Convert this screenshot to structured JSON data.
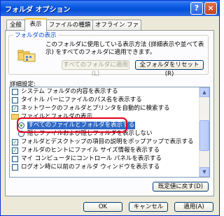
{
  "window": {
    "title": "フォルダ オプション",
    "help_label": "?",
    "close_label": "×"
  },
  "tabs": [
    {
      "label": "全般"
    },
    {
      "label": "表示"
    },
    {
      "label": "ファイルの種類"
    },
    {
      "label": "オフライン ファイル"
    }
  ],
  "folder_view": {
    "group_label": "フォルダの表示",
    "description": "このフォルダに使用している表示方法 (詳細表示や並べて表示) をすべてのフォルダに適用できます。",
    "apply_all_label": "すべてのフォルダに適用(L)",
    "reset_all_label": "全フォルダをリセット(R)"
  },
  "advanced": {
    "label": "詳細設定:",
    "items": [
      {
        "type": "checkbox",
        "checked": false,
        "label": "システム フォルダの内容を表示する"
      },
      {
        "type": "checkbox",
        "checked": false,
        "label": "タイトル バーにファイルのパス名を表示する"
      },
      {
        "type": "checkbox",
        "checked": true,
        "label": "ネットワークのフォルダとプリンタを自動的に検索する"
      },
      {
        "type": "folder",
        "label": "ファイルとフォルダの表示"
      },
      {
        "type": "radio",
        "checked": true,
        "label": "すべてのファイルとフォルダを表示する"
      },
      {
        "type": "radio",
        "checked": false,
        "label": "隠しファイルおよび隠しフォルダを表示しない"
      },
      {
        "type": "checkbox",
        "checked": true,
        "label": "フォルダとデスクトップの項目の説明をポップアップで表示する"
      },
      {
        "type": "checkbox",
        "checked": true,
        "label": "フォルダのヒントにファイル サイズ情報を表示する"
      },
      {
        "type": "checkbox",
        "checked": false,
        "label": "マイ コンピュータにコントロール パネルを表示する"
      },
      {
        "type": "checkbox",
        "checked": false,
        "label": "ログオン時に以前のフォルダ ウィンドウを表示する"
      }
    ],
    "restore_label": "既定値に戻す(D)"
  },
  "footer": {
    "ok_label": "OK",
    "cancel_label": "キャンセル",
    "apply_label": "適用(A)"
  },
  "colors": {
    "title_bar": "#0a5ae2",
    "selection": "#316ac5",
    "highlight_ring": "#e0001b",
    "check": "#21a121"
  }
}
